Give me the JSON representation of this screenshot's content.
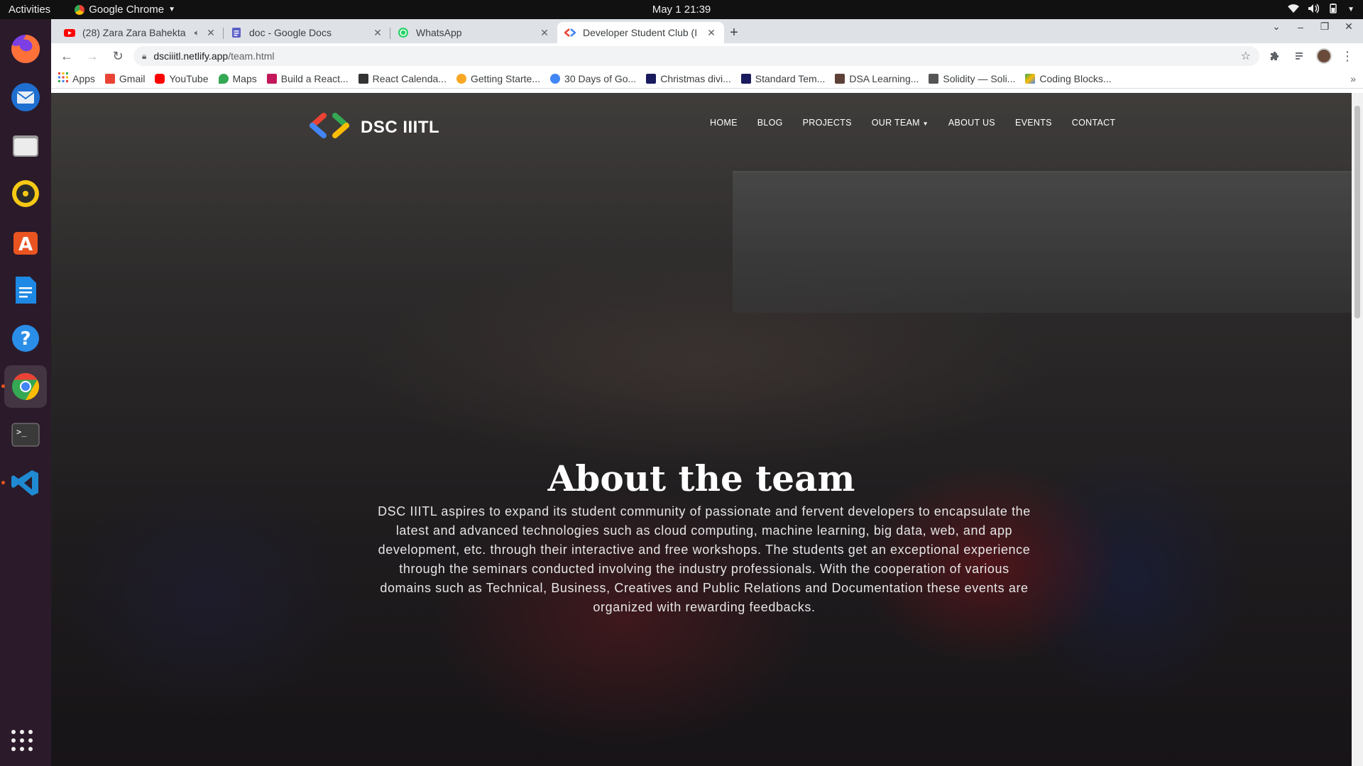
{
  "topbar": {
    "activities": "Activities",
    "app_name": "Google Chrome",
    "clock": "May 1  21:39"
  },
  "dock": {
    "items": [
      "firefox-icon",
      "thunderbird-icon",
      "files-icon",
      "rhythmbox-icon",
      "software-icon",
      "writer-icon",
      "help-icon",
      "chrome-icon",
      "terminal-icon",
      "vscode-icon"
    ]
  },
  "browser": {
    "tabs": [
      {
        "title": "(28) Zara Zara Bahekta",
        "favicon_color": "#ff0000"
      },
      {
        "title": "doc - Google Docs",
        "favicon_color": "#4285f4"
      },
      {
        "title": "WhatsApp",
        "favicon_color": "#25d366"
      },
      {
        "title": "Developer Student Club (I",
        "favicon_color": "#ea4335"
      }
    ],
    "url_host": "dsciiitl.netlify.app",
    "url_path": "/team.html",
    "bookmarks": [
      {
        "label": "Apps",
        "color": "#4285f4"
      },
      {
        "label": "Gmail",
        "color": "#ea4335"
      },
      {
        "label": "YouTube",
        "color": "#ff0000"
      },
      {
        "label": "Maps",
        "color": "#34a853"
      },
      {
        "label": "Build a React...",
        "color": "#c2185b"
      },
      {
        "label": "React Calenda...",
        "color": "#333333"
      },
      {
        "label": "Getting Starte...",
        "color": "#f9a825"
      },
      {
        "label": "30 Days of Go...",
        "color": "#4285f4"
      },
      {
        "label": "Christmas divi...",
        "color": "#1a1a5e"
      },
      {
        "label": "Standard Tem...",
        "color": "#1a1a5e"
      },
      {
        "label": "DSA Learning...",
        "color": "#5d4037"
      },
      {
        "label": "Solidity — Soli...",
        "color": "#555555"
      },
      {
        "label": "Coding Blocks...",
        "color": "#34a853"
      }
    ],
    "bookmarks_more": "»"
  },
  "site": {
    "logo_text": "DSC IIITL",
    "nav": [
      "HOME",
      "BLOG",
      "PROJECTS",
      "OUR TEAM",
      "ABOUT US",
      "EVENTS",
      "CONTACT"
    ],
    "hero_title": "About the team",
    "hero_text": "DSC IIITL aspires to expand its student community of passionate and fervent developers to encapsulate the latest and advanced technologies such as cloud computing, machine learning, big data, web, and app development, etc. through their interactive and free workshops. The students get an exceptional experience through the seminars conducted involving the industry professionals. With the cooperation of various domains such as Technical, Business, Creatives and Public Relations and Documentation these events are organized with rewarding feedbacks."
  }
}
